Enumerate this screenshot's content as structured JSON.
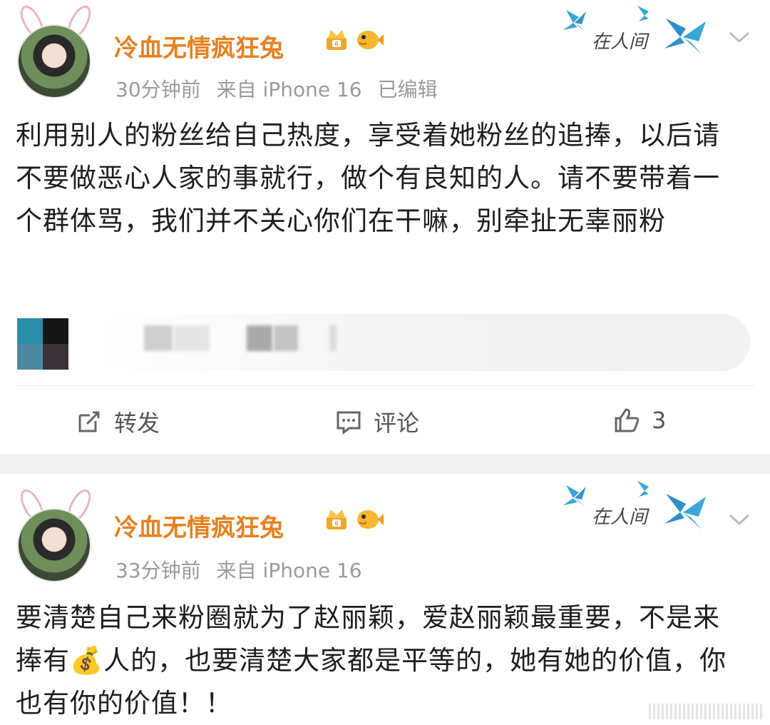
{
  "posts": [
    {
      "username": "冷血无情疯狂兔",
      "time": "30分钟前",
      "source": "来自 iPhone 16",
      "edited": "已编辑",
      "decor_text": "在人间",
      "body": "利用别人的粉丝给自己热度，享受着她粉丝的追捧，以后请不要做恶心人家的事就行，做个有良知的人。请不要带着一个群体骂，我们并不关心你们在干嘛，别牵扯无辜丽粉",
      "actions": {
        "repost": "转发",
        "comment": "评论",
        "like_count": "3"
      }
    },
    {
      "username": "冷血无情疯狂兔",
      "time": "33分钟前",
      "source": "来自 iPhone 16",
      "decor_text": "在人间",
      "body_before_emoji": "要清楚自己来粉圈就为了赵丽颖，爱赵丽颖最重要，不是来捧有",
      "emoji": "💰",
      "body_after_emoji": "人的，也要清楚大家都是平等的，她有她的价值，你也有你的价值！！"
    }
  ],
  "colors": {
    "username": "#e8801f",
    "meta": "#9a9a9a",
    "separator": "#f2f2f2",
    "butterfly": "#3aa6d6"
  }
}
